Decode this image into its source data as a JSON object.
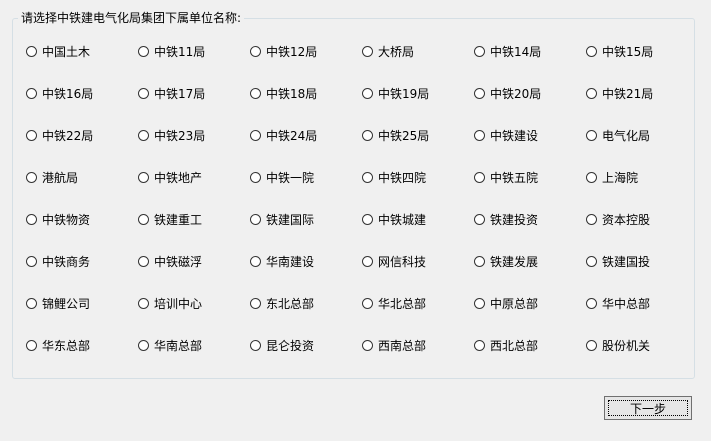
{
  "group": {
    "title": "请选择中铁建电气化局集团下属单位名称:"
  },
  "options": [
    "中国土木",
    "中铁11局",
    "中铁12局",
    "大桥局",
    "中铁14局",
    "中铁15局",
    "中铁16局",
    "中铁17局",
    "中铁18局",
    "中铁19局",
    "中铁20局",
    "中铁21局",
    "中铁22局",
    "中铁23局",
    "中铁24局",
    "中铁25局",
    "中铁建设",
    "电气化局",
    "港航局",
    "中铁地产",
    "中铁一院",
    "中铁四院",
    "中铁五院",
    "上海院",
    "中铁物资",
    "铁建重工",
    "铁建国际",
    "中铁城建",
    "铁建投资",
    "资本控股",
    "中铁商务",
    "中铁磁浮",
    "华南建设",
    "网信科技",
    "铁建发展",
    "铁建国投",
    "锦鲤公司",
    "培训中心",
    "东北总部",
    "华北总部",
    "中原总部",
    "华中总部",
    "华东总部",
    "华南总部",
    "昆仑投资",
    "西南总部",
    "西北总部",
    "股份机关"
  ],
  "buttons": {
    "next_label": "下一步"
  }
}
